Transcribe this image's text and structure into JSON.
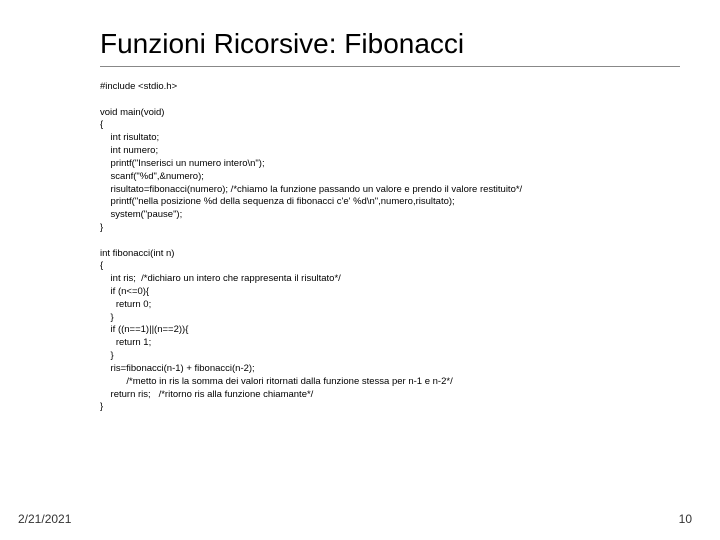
{
  "title": "Funzioni Ricorsive: Fibonacci",
  "code": "#include <stdio.h>\n\nvoid main(void)\n{\n    int risultato;\n    int numero;\n    printf(\"Inserisci un numero intero\\n\");\n    scanf(\"%d\",&numero);\n    risultato=fibonacci(numero); /*chiamo la funzione passando un valore e prendo il valore restituito*/\n    printf(\"nella posizione %d della sequenza di fibonacci c'e' %d\\n\",numero,risultato);\n    system(\"pause\");\n}\n\nint fibonacci(int n)\n{\n    int ris;  /*dichiaro un intero che rappresenta il risultato*/\n    if (n<=0){\n      return 0;\n    }\n    if ((n==1)||(n==2)){\n      return 1;\n    }\n    ris=fibonacci(n-1) + fibonacci(n-2);\n          /*metto in ris la somma dei valori ritornati dalla funzione stessa per n-1 e n-2*/\n    return ris;   /*ritorno ris alla funzione chiamante*/\n}",
  "footer": {
    "date": "2/21/2021",
    "page": "10"
  }
}
